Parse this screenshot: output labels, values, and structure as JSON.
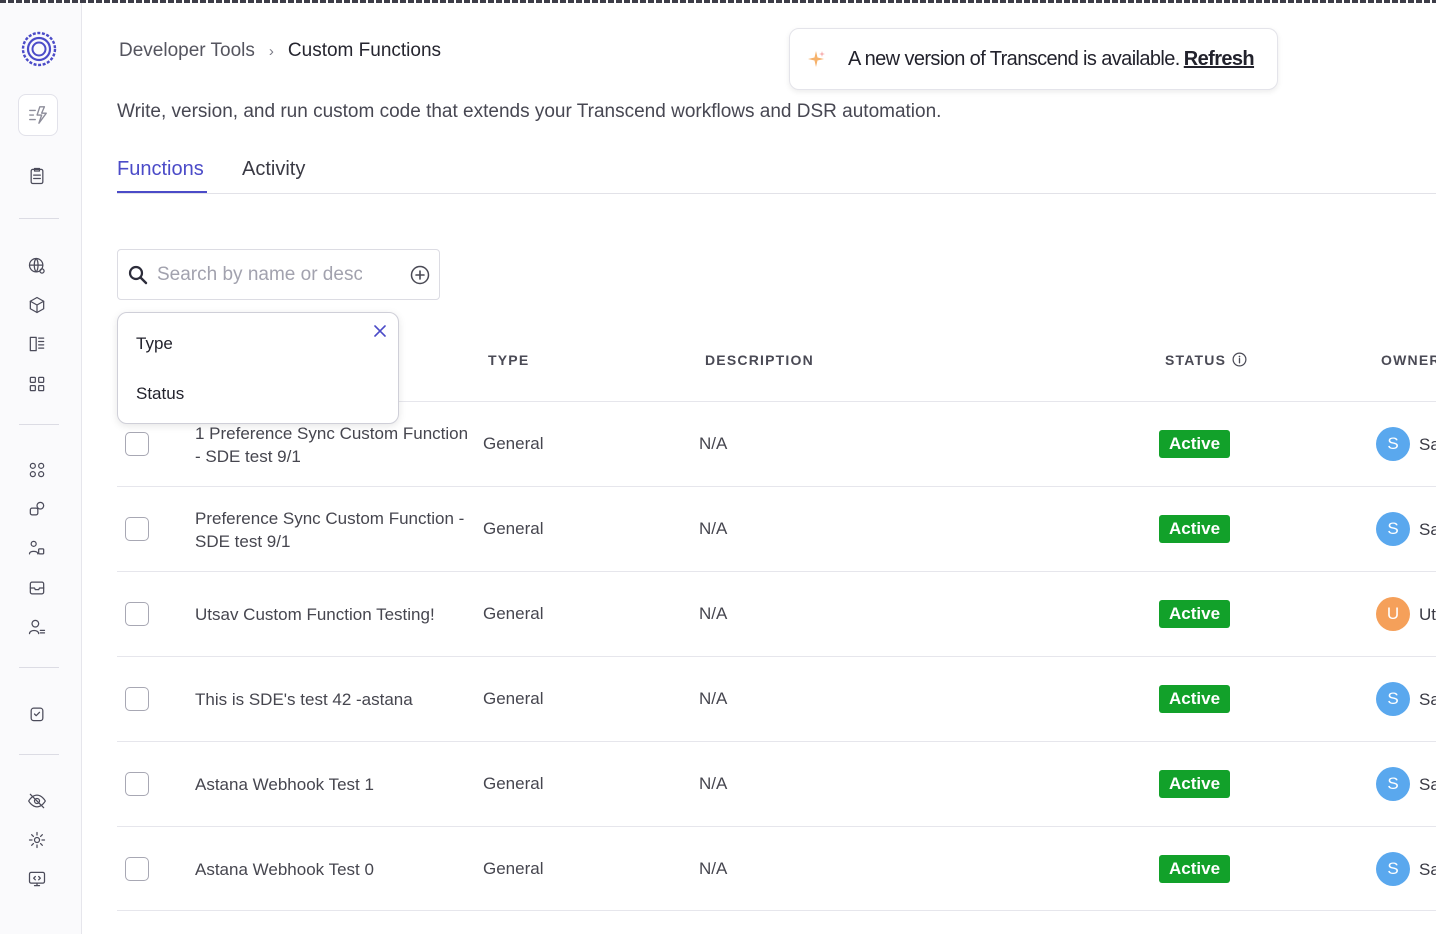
{
  "breadcrumb": {
    "parent": "Developer Tools",
    "separator": "›",
    "current": "Custom Functions"
  },
  "toast": {
    "message": "A new version of Transcend is available.",
    "link": "Refresh"
  },
  "subtitle": "Write, version, and run custom code that extends your Transcend workflows and DSR automation.",
  "tabs": [
    {
      "label": "Functions",
      "active": true
    },
    {
      "label": "Activity",
      "active": false
    }
  ],
  "search": {
    "placeholder": "Search by name or description",
    "value": ""
  },
  "filter_dropdown": {
    "items": [
      "Type",
      "Status"
    ]
  },
  "table": {
    "headers": {
      "type": "TYPE",
      "description": "DESCRIPTION",
      "status": "STATUS",
      "owner": "OWNER"
    },
    "rows": [
      {
        "name": "1 Preference Sync Custom Function - SDE test 9/1",
        "type": "General",
        "description": "N/A",
        "status": "Active",
        "owner_initial": "S",
        "owner_text": "Sa",
        "avatar_color": "#5aa8ee"
      },
      {
        "name": "Preference Sync Custom Function - SDE test 9/1",
        "type": "General",
        "description": "N/A",
        "status": "Active",
        "owner_initial": "S",
        "owner_text": "Sa",
        "avatar_color": "#5aa8ee"
      },
      {
        "name": "Utsav Custom Function Testing!",
        "type": "General",
        "description": "N/A",
        "status": "Active",
        "owner_initial": "U",
        "owner_text": "Ut",
        "avatar_color": "#f5a05a"
      },
      {
        "name": "This is SDE's test 42 -astana",
        "type": "General",
        "description": "N/A",
        "status": "Active",
        "owner_initial": "S",
        "owner_text": "Sa",
        "avatar_color": "#5aa8ee"
      },
      {
        "name": "Astana Webhook Test 1",
        "type": "General",
        "description": "N/A",
        "status": "Active",
        "owner_initial": "S",
        "owner_text": "Sa",
        "avatar_color": "#5aa8ee"
      },
      {
        "name": "Astana Webhook Test 0",
        "type": "General",
        "description": "N/A",
        "status": "Active",
        "owner_initial": "S",
        "owner_text": "Sa",
        "avatar_color": "#5aa8ee"
      }
    ]
  },
  "colors": {
    "accent": "#4b4bc8",
    "active_badge": "#12a12a"
  }
}
